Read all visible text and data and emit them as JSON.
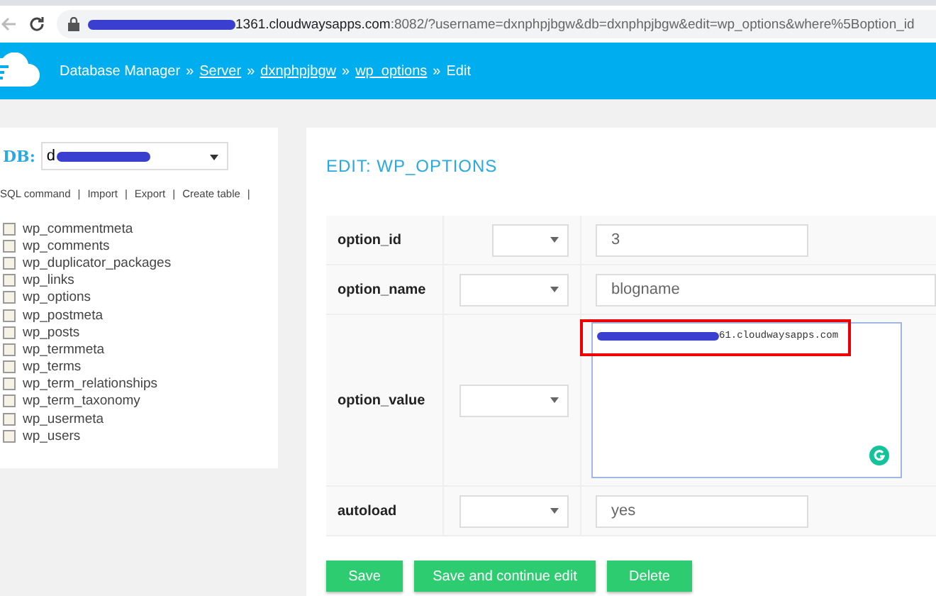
{
  "address_bar": {
    "host": "1361.cloudwaysapps.com",
    "path": ":8082/?username=dxnphpjbgw&db=dxnphpjbgw&edit=wp_options&where%5Boption_id"
  },
  "header": {
    "breadcrumb": [
      {
        "text": "Database Manager",
        "link": false
      },
      {
        "text": "Server",
        "link": true
      },
      {
        "text": "dxnphpjbgw",
        "link": true
      },
      {
        "text": "wp_options",
        "link": true
      },
      {
        "text": "Edit",
        "link": false
      }
    ],
    "separator": "»"
  },
  "sidebar": {
    "db_label": "DB:",
    "db_value": "d",
    "links": [
      "SQL command",
      "Import",
      "Export",
      "Create table"
    ],
    "link_separator": "|",
    "tables": [
      "wp_commentmeta",
      "wp_comments",
      "wp_duplicator_packages",
      "wp_links",
      "wp_options",
      "wp_postmeta",
      "wp_posts",
      "wp_termmeta",
      "wp_terms",
      "wp_term_relationships",
      "wp_term_taxonomy",
      "wp_usermeta",
      "wp_users"
    ]
  },
  "form": {
    "title": "EDIT: WP_OPTIONS",
    "fields": [
      {
        "name": "option_id",
        "kind": "input",
        "value": "3"
      },
      {
        "name": "option_name",
        "kind": "input",
        "value": "blogname"
      },
      {
        "name": "option_value",
        "kind": "textarea",
        "value": "61.cloudwaysapps.com"
      },
      {
        "name": "autoload",
        "kind": "input",
        "value": "yes"
      }
    ],
    "buttons": [
      "Save",
      "Save and continue edit",
      "Delete"
    ]
  }
}
